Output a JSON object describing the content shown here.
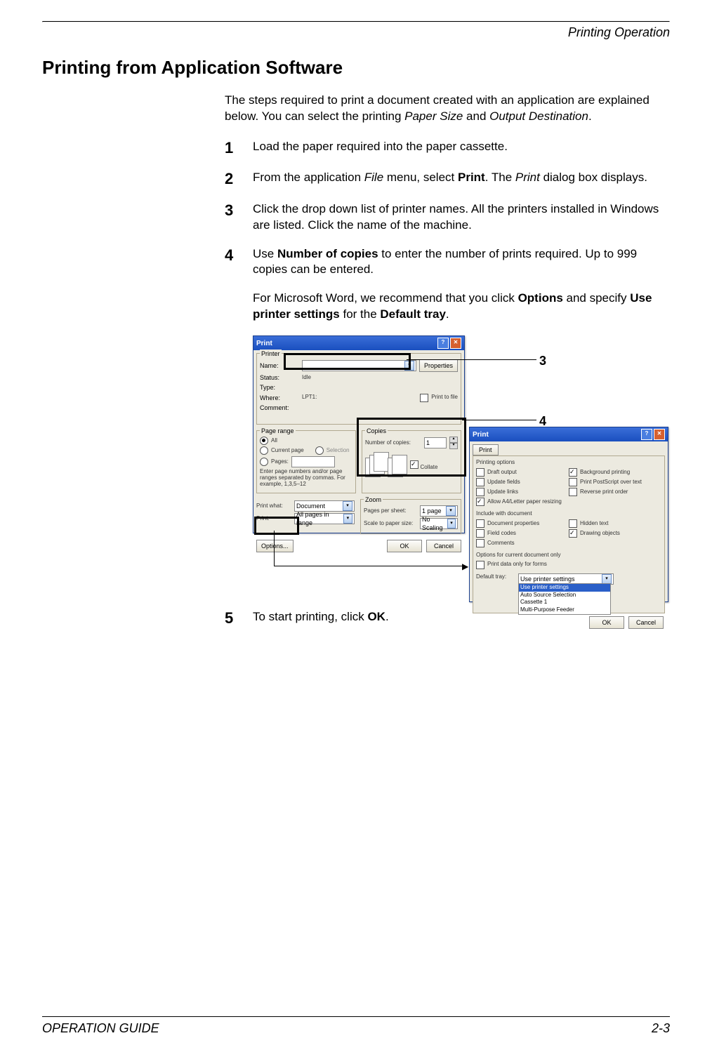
{
  "header": "Printing Operation",
  "section_title": "Printing from Application Software",
  "intro": {
    "t1": "The steps required to print a document created with an application are explained below. You can select the printing ",
    "i1": "Paper Size",
    "t2": " and ",
    "i2": "Output Destination",
    "t3": "."
  },
  "steps": {
    "s1": {
      "num": "1",
      "text": "Load the paper required into the paper cassette."
    },
    "s2": {
      "num": "2",
      "t1": "From the application ",
      "i1": "File",
      "t2": " menu, select ",
      "b1": "Print",
      "t3": ". The ",
      "i2": "Print",
      "t4": " dialog box displays."
    },
    "s3": {
      "num": "3",
      "text": "Click the drop down list of printer names. All the printers installed in Windows are listed. Click the name of the machine."
    },
    "s4": {
      "num": "4",
      "t1": "Use ",
      "b1": "Number of copies",
      "t2": " to enter the number of prints required. Up to 999 copies can be entered."
    },
    "s4_note": {
      "t1": "For Microsoft Word, we recommend that you click ",
      "b1": "Options",
      "t2": " and specify ",
      "b2": "Use printer settings",
      "t3": " for the ",
      "b3": "Default tray",
      "t4": "."
    },
    "s5": {
      "num": "5",
      "t1": "To start printing, click ",
      "b1": "OK",
      "t2": "."
    }
  },
  "callouts": {
    "c3": "3",
    "c4": "4"
  },
  "dialog1": {
    "title": "Print",
    "printer_group": "Printer",
    "name_lbl": "Name:",
    "name_val": "",
    "properties_btn": "Properties",
    "status_lbl": "Status:",
    "status_val": "Idle",
    "type_lbl": "Type:",
    "where_lbl": "Where:",
    "where_val": "LPT1:",
    "comment_lbl": "Comment:",
    "print_to_file": "Print to file",
    "pagerange_group": "Page range",
    "all": "All",
    "current": "Current page",
    "selection": "Selection",
    "pages_lbl": "Pages:",
    "pagehint": "Enter page numbers and/or page ranges separated by commas. For example, 1,3,5–12",
    "copies_group": "Copies",
    "numcopies_lbl": "Number of copies:",
    "numcopies_val": "1",
    "collate": "Collate",
    "zoom_group": "Zoom",
    "printwhat_lbl": "Print what:",
    "printwhat_val": "Document",
    "print_lbl": "Print:",
    "print_val": "All pages in range",
    "pagespersheet_lbl": "Pages per sheet:",
    "pagespersheet_val": "1 page",
    "scale_lbl": "Scale to paper size:",
    "scale_val": "No Scaling",
    "options_btn": "Options...",
    "ok_btn": "OK",
    "cancel_btn": "Cancel"
  },
  "dialog2": {
    "title": "Print",
    "tab": "Print",
    "printing_options": "Printing options",
    "draft": "Draft output",
    "updatefields": "Update fields",
    "updatelinks": "Update links",
    "allowa4": "Allow A4/Letter paper resizing",
    "bgprint": "Background printing",
    "postscript": "Print PostScript over text",
    "reverse": "Reverse print order",
    "include_group": "Include with document",
    "docprops": "Document properties",
    "fieldcodes": "Field codes",
    "comments": "Comments",
    "hidden": "Hidden text",
    "drawing": "Drawing objects",
    "current_only": "Options for current document only",
    "formsonly": "Print data only for forms",
    "default_tray_lbl": "Default tray:",
    "opt_useprinter": "Use printer settings",
    "opt_useprinter2": "Use printer settings",
    "opt_auto": "Auto Source Selection",
    "opt_cass": "Cassette 1",
    "opt_mp": "Multi-Purpose Feeder",
    "ok_btn": "OK",
    "cancel_btn": "Cancel"
  },
  "footer": {
    "guide": "OPERATION GUIDE",
    "page": "2-3"
  }
}
